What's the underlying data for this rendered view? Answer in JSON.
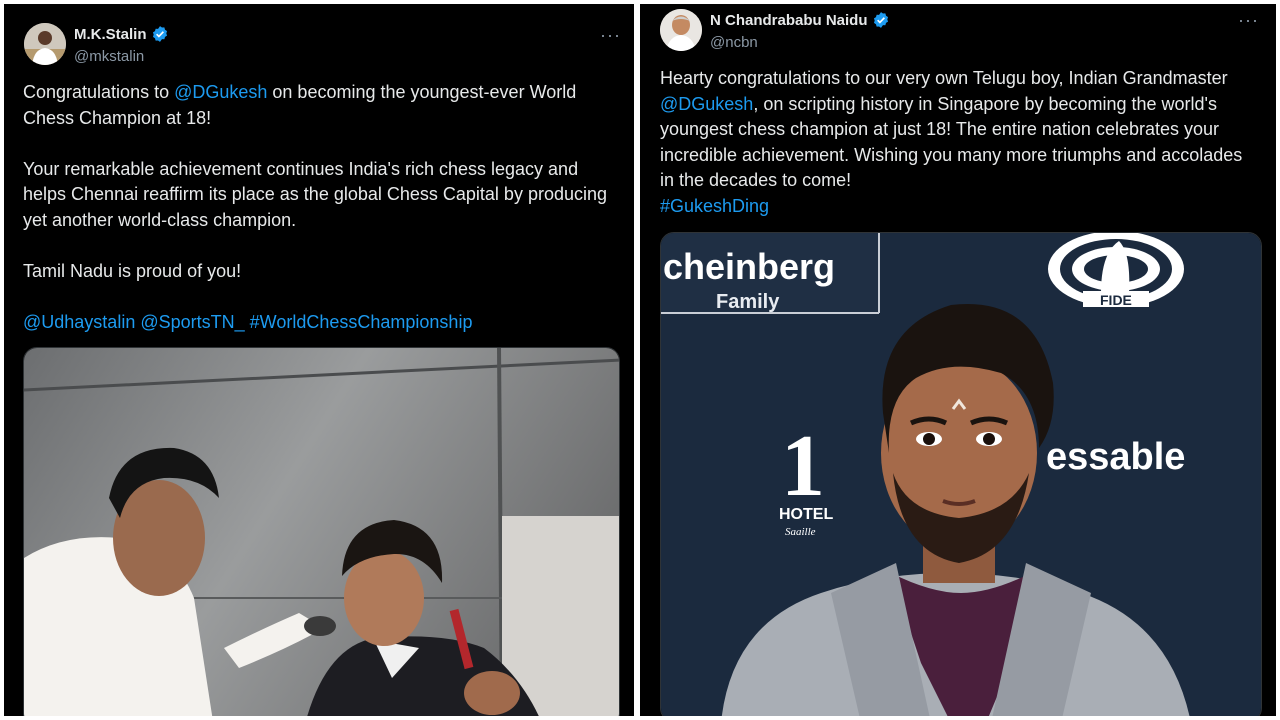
{
  "tweets": {
    "left": {
      "author_name": "M.K.Stalin",
      "handle": "@mkstalin",
      "more_icon": "···",
      "p1_pre": "Congratulations to ",
      "p1_mention": "@DGukesh",
      "p1_post": " on becoming the youngest-ever World Chess Champion at 18!",
      "p2": "Your remarkable achievement continues India's rich chess legacy and helps Chennai reaffirm its place as the global Chess Capital by producing yet another world-class champion.",
      "p3": "Tamil Nadu is proud of you!",
      "mention1": "@Udhaystalin",
      "mention2": "@SportsTN_",
      "hashtag": "#WorldChessChampionship"
    },
    "right": {
      "author_name": "N Chandrababu Naidu",
      "handle": "@ncbn",
      "more_icon": "···",
      "p1_pre": "Hearty congratulations to our very own Telugu boy, Indian Grandmaster ",
      "p1_mention": "@DGukesh",
      "p1_post": ", on scripting history in Singapore by becoming the world's youngest chess champion at just 18! The entire nation celebrates your incredible achievement. Wishing you many more triumphs and accolades in the decades to come!",
      "hashtag": "#GukeshDing",
      "backdrop": {
        "brand1": "cheinberg",
        "brand1_sub": "Family",
        "fide": "FIDE",
        "number": "1",
        "hotel": "HOTEL",
        "hotel_sub": "Saaille",
        "brand2": "essable"
      }
    }
  },
  "colors": {
    "background": "#000000",
    "text": "#e7e9ea",
    "muted": "#8b98a5",
    "link": "#1d9bf0",
    "verified": "#1d9bf0"
  },
  "icons": {
    "verified": "verified-badge-icon",
    "more": "more-options-icon"
  }
}
